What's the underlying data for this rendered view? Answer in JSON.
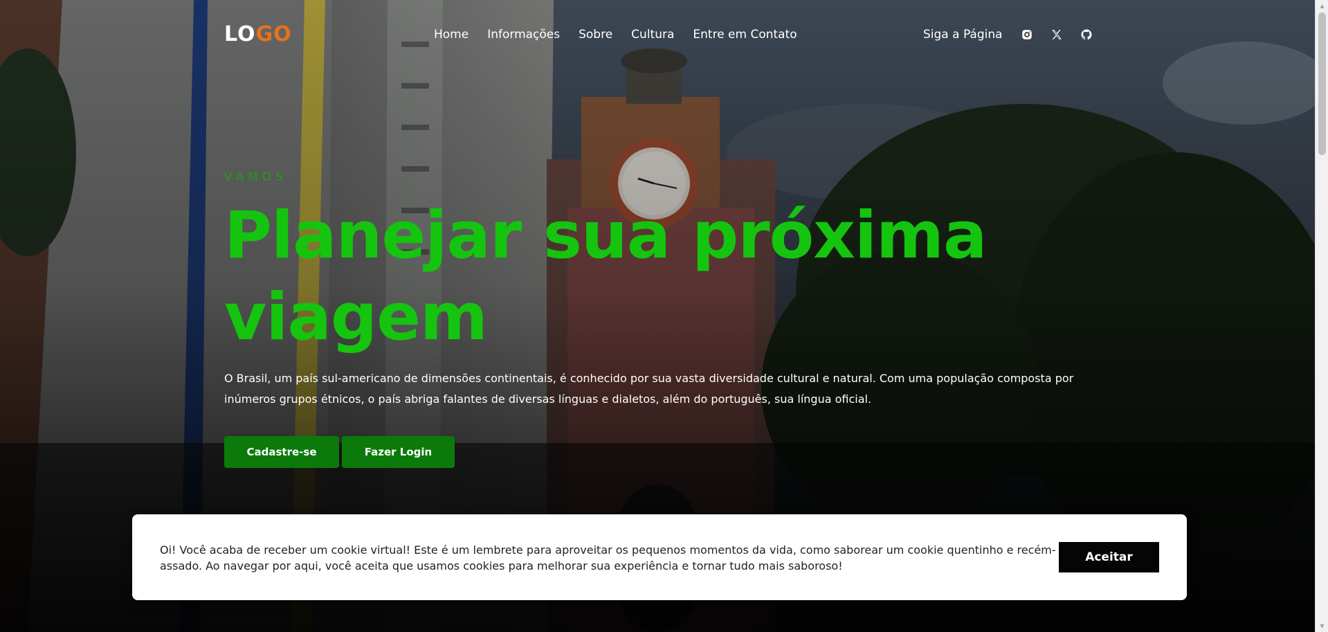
{
  "header": {
    "logo_part1": "LO",
    "logo_part2": "GO",
    "nav": [
      {
        "label": "Home"
      },
      {
        "label": "Informações"
      },
      {
        "label": "Sobre"
      },
      {
        "label": "Cultura"
      },
      {
        "label": "Entre em Contato"
      }
    ],
    "follow_label": "Siga a Página",
    "social_icons": [
      "instagram-icon",
      "x-twitter-icon",
      "github-icon"
    ]
  },
  "hero": {
    "eyebrow": "VAMOS",
    "headline": "Planejar sua próxima viagem",
    "intro": "O Brasil, um país sul-americano de dimensões continentais, é conhecido por sua vasta diversidade cultural e natural. Com uma população composta por inúmeros grupos étnicos, o país abriga falantes de diversas línguas e dialetos, além do português, sua língua oficial.",
    "signup_label": "Cadastre-se",
    "login_label": "Fazer Login"
  },
  "cookie": {
    "text": "Oi! Você acaba de receber um cookie virtual! Este é um lembrete para aproveitar os pequenos momentos da vida, como saborear um cookie quentinho e recém-assado. Ao navegar por aqui, você aceita que usamos cookies para melhorar sua experiência e tornar tudo mais saboroso!",
    "accept_label": "Aceitar"
  },
  "colors": {
    "accent_green": "#15c40e",
    "button_green": "#0b7a0b",
    "logo_orange": "#e8711c"
  }
}
